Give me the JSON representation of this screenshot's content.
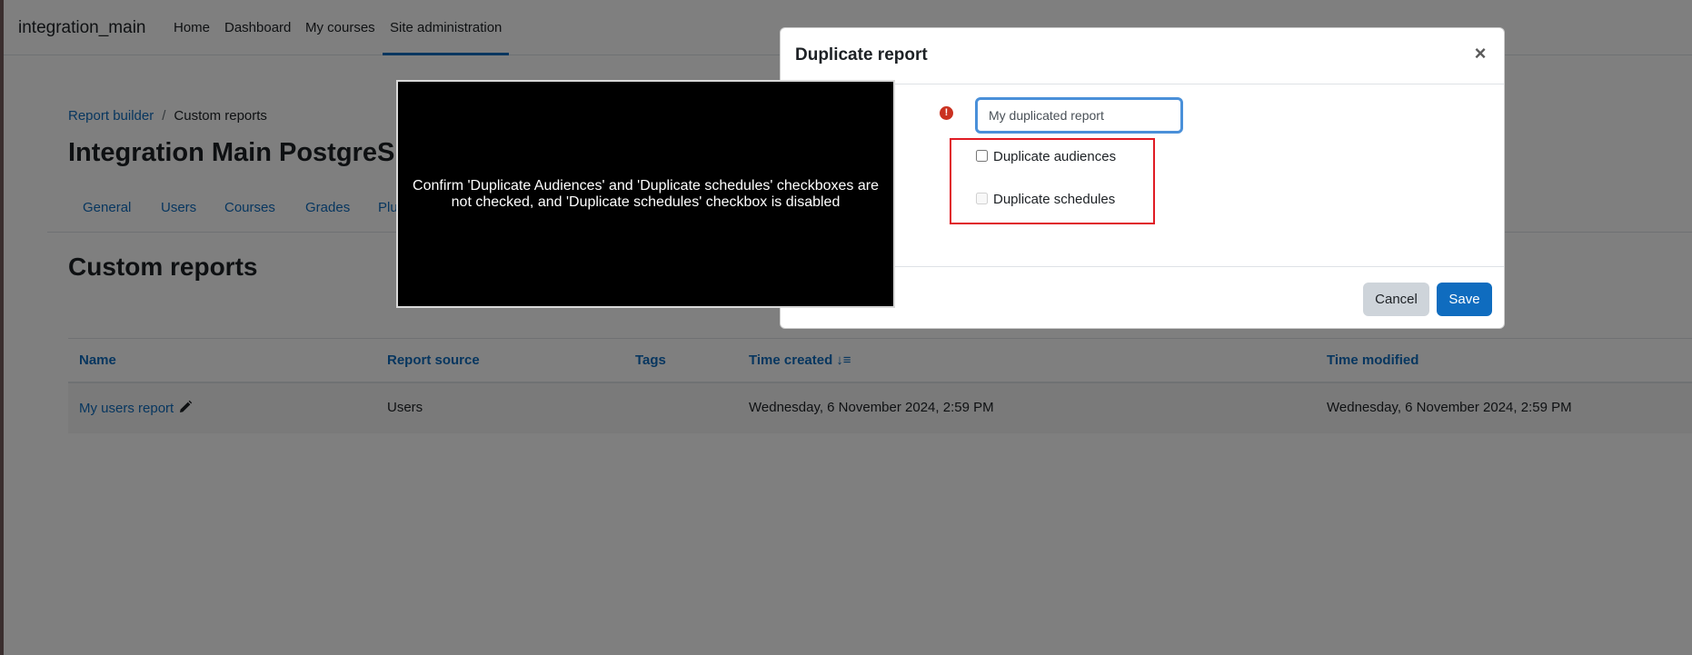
{
  "navbar": {
    "brand": "integration_main",
    "items": [
      {
        "label": "Home"
      },
      {
        "label": "Dashboard"
      },
      {
        "label": "My courses"
      },
      {
        "label": "Site administration"
      }
    ]
  },
  "breadcrumb": {
    "items": [
      {
        "label": "Report builder"
      },
      {
        "label": "Custom reports"
      }
    ],
    "separator": "/"
  },
  "site_title": "Integration Main PostgreS",
  "secondary_nav": {
    "items": [
      {
        "label": "General"
      },
      {
        "label": "Users"
      },
      {
        "label": "Courses"
      },
      {
        "label": "Grades"
      },
      {
        "label": "Plu"
      }
    ]
  },
  "page_heading": "Custom reports",
  "table": {
    "columns": [
      {
        "label": "Name"
      },
      {
        "label": "Report source"
      },
      {
        "label": "Tags"
      },
      {
        "label": "Time created"
      },
      {
        "label": "Time modified"
      }
    ],
    "rows": [
      {
        "name": "My users report",
        "source": "Users",
        "tags": "",
        "created": "Wednesday, 6 November 2024, 2:59 PM",
        "modified": "Wednesday, 6 November 2024, 2:59 PM"
      }
    ]
  },
  "modal": {
    "title": "Duplicate report",
    "close_symbol": "×",
    "required_symbol": "!",
    "name_value": "My duplicated report",
    "checkboxes": [
      {
        "label": "Duplicate audiences",
        "checked": false,
        "disabled": false
      },
      {
        "label": "Duplicate schedules",
        "checked": false,
        "disabled": true
      }
    ],
    "cancel_label": "Cancel",
    "save_label": "Save"
  },
  "annotation": {
    "text": "Confirm 'Duplicate Audiences' and 'Duplicate schedules' checkboxes are not checked, and 'Duplicate schedules' checkbox is disabled"
  },
  "colors": {
    "link": "#0f6cbf",
    "primary_button": "#0f6cbf",
    "highlight": "#e01b24",
    "required": "#ca3120"
  }
}
